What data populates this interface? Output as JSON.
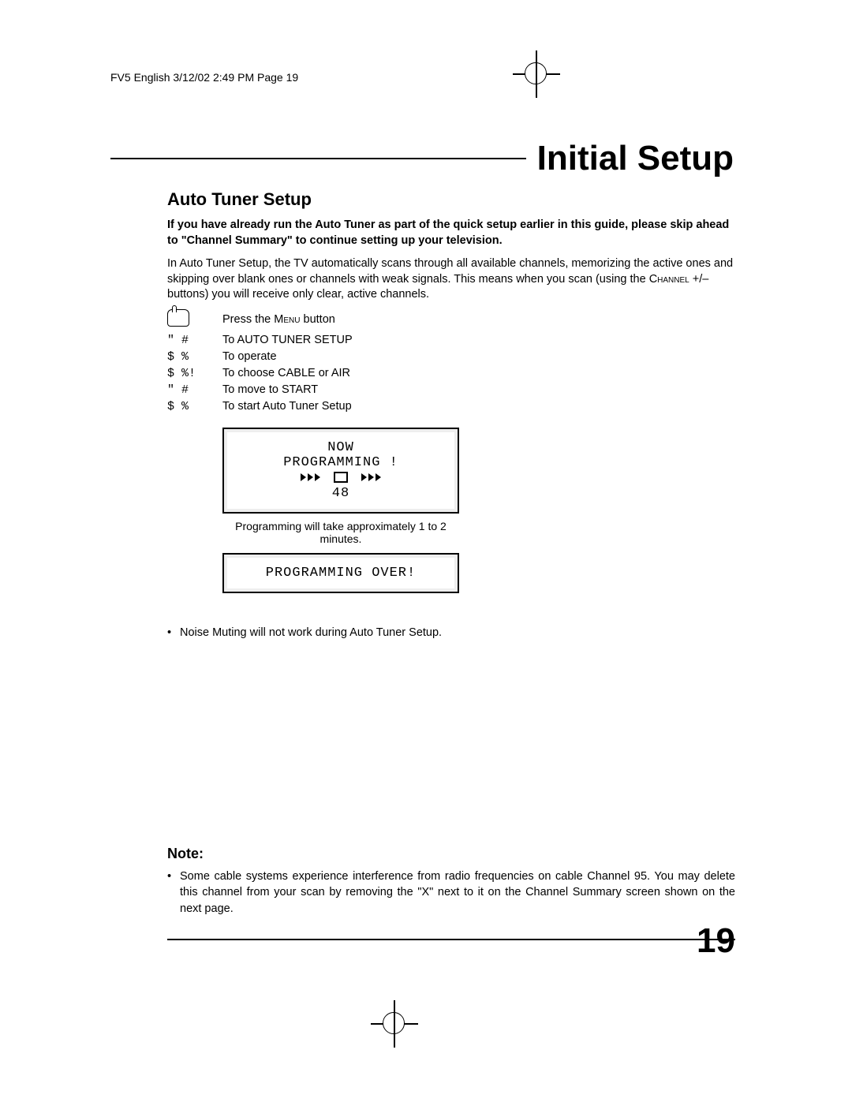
{
  "slug": "FV5 English  3/12/02  2:49 PM  Page 19",
  "page_title": "Initial Setup",
  "section_title": "Auto Tuner Setup",
  "intro_bold": "If you have already run the Auto Tuner as part of the quick setup earlier in this guide, please skip ahead to \"Channel Summary\" to continue setting up your television.",
  "intro_body_a": "In Auto Tuner Setup, the TV automatically scans through all available channels, memorizing the active ones and skipping over blank ones or channels with weak signals. This means when you scan (using the ",
  "intro_body_smallcaps1": "Channel",
  "intro_body_b": " +/– buttons) you will receive only clear, active channels.",
  "steps": [
    {
      "icon": "hand",
      "text_a": "Press the ",
      "smallcaps": "Menu",
      "text_b": " button"
    },
    {
      "icon": "\"  #",
      "text": "To AUTO TUNER SETUP"
    },
    {
      "icon": "$  %",
      "text": "To operate"
    },
    {
      "icon": "$  %!",
      "text": "To choose CABLE or AIR"
    },
    {
      "icon": "\"  #",
      "text": "To move to START"
    },
    {
      "icon": "$  %",
      "text": "To start Auto Tuner Setup"
    }
  ],
  "osd1_line1": "NOW",
  "osd1_line2": "PROGRAMMING !",
  "osd1_channel": "48",
  "programming_caption": "Programming will take approximately 1 to 2 minutes.",
  "osd2_text": "PROGRAMMING OVER!",
  "bullet1": "Noise Muting will not work during Auto Tuner Setup.",
  "note_heading": "Note:",
  "note_bullet": "Some cable systems experience interference from radio frequencies on cable Channel 95. You may delete this channel from your scan by removing the \"X\" next to it on the Channel Summary screen shown on the next page.",
  "page_number": "19"
}
